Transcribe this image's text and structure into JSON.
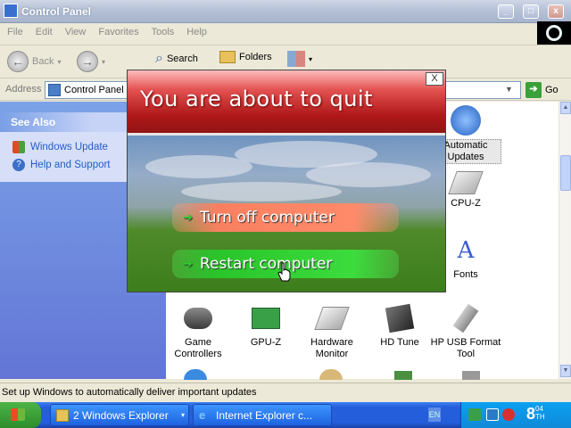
{
  "window": {
    "title": "Control Panel",
    "menu": [
      "File",
      "Edit",
      "View",
      "Favorites",
      "Tools",
      "Help"
    ],
    "toolbar": {
      "back": "Back",
      "search": "Search",
      "folders": "Folders"
    },
    "address": {
      "label": "Address",
      "value": "Control Panel",
      "go": "Go"
    }
  },
  "sidebar": {
    "see_also_title": "See Also",
    "links": [
      "Windows Update",
      "Help and Support"
    ]
  },
  "items": [
    {
      "label": "Automatic Updates"
    },
    {
      "label": "CPU-Z"
    },
    {
      "label": "Fonts"
    },
    {
      "label": "Game Controllers"
    },
    {
      "label": "GPU-Z"
    },
    {
      "label": "Hardware Monitor"
    },
    {
      "label": "HD Tune"
    },
    {
      "label": "HP USB Format Tool"
    }
  ],
  "status_text": "Set up Windows to automatically deliver important updates",
  "dialog": {
    "title": "You are about to quit",
    "close": "X",
    "options": [
      "Turn off computer",
      "Restart computer"
    ]
  },
  "taskbar": {
    "tasks": [
      "2 Windows Explorer",
      "Internet Explorer c..."
    ],
    "lang": "EN",
    "clock": "8",
    "clock_sup": "04",
    "clock_sub": "TH"
  },
  "colors": {
    "xp_blue": "#245edb",
    "dialog_red": "#b01818",
    "restart_green": "#29c52b",
    "turnoff_orange": "#f88060"
  }
}
